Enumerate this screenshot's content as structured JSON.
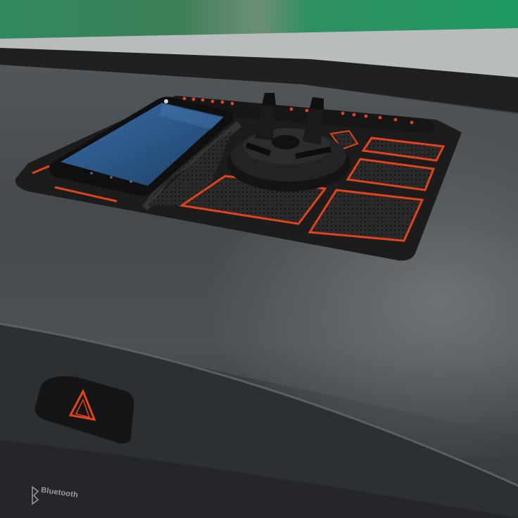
{
  "scene": {
    "description_free": true,
    "bluetooth_label": "Bluetooth",
    "colors": {
      "dashboard": "#3e4245",
      "mat": "#1c1c1d",
      "accent": "#e0431d",
      "glass_green": "#2f8a5c",
      "phone_screen": "#2a5c8e"
    },
    "icons": [
      "hazard-warning-icon",
      "phone-holder-icon",
      "smartphone-icon"
    ]
  }
}
